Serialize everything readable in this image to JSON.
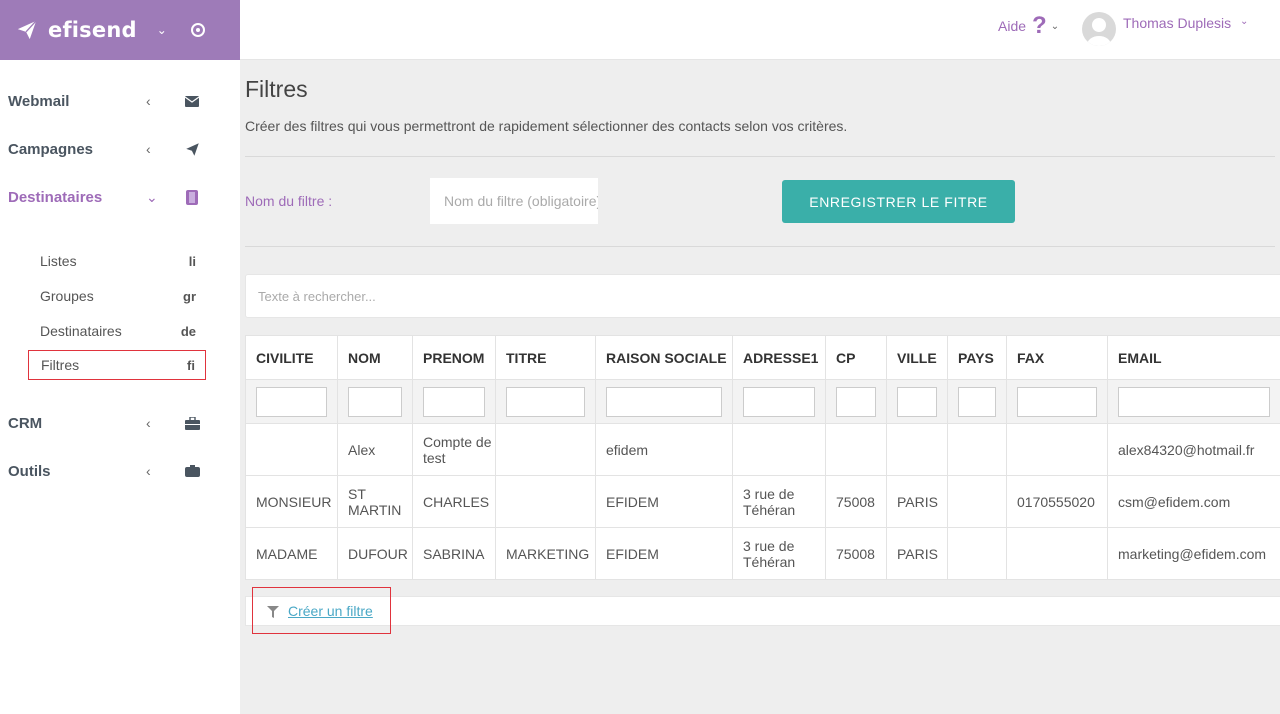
{
  "brand": {
    "name": "efisend"
  },
  "sidebar": {
    "items": [
      {
        "label": "Webmail",
        "icon": "envelope-icon"
      },
      {
        "label": "Campagnes",
        "icon": "paper-plane-icon"
      },
      {
        "label": "Destinataires",
        "icon": "address-book-icon"
      },
      {
        "label": "CRM",
        "icon": "briefcase-icon"
      },
      {
        "label": "Outils",
        "icon": "toolbox-icon"
      }
    ],
    "subitems": [
      {
        "label": "Listes",
        "abbr": "li"
      },
      {
        "label": "Groupes",
        "abbr": "gr"
      },
      {
        "label": "Destinataires",
        "abbr": "de"
      },
      {
        "label": "Filtres",
        "abbr": "fi"
      }
    ]
  },
  "header": {
    "help_label": "Aide",
    "help_symbol": "?",
    "user_name": "Thomas Duplesis"
  },
  "main": {
    "title": "Filtres",
    "description": "Créer des filtres qui vous permettront de rapidement sélectionner des contacts selon vos critères.",
    "filter_name_label": "Nom du filtre :",
    "filter_name_placeholder": "Nom du filtre (obligatoire)",
    "save_button": "ENREGISTRER LE FITRE",
    "search_placeholder": "Texte à rechercher...",
    "create_filter_link": "Créer un filtre"
  },
  "table": {
    "columns": [
      "CIVILITE",
      "NOM",
      "PRENOM",
      "TITRE",
      "RAISON SOCIALE",
      "ADRESSE1",
      "CP",
      "VILLE",
      "PAYS",
      "FAX",
      "EMAIL"
    ],
    "rows": [
      [
        "",
        "Alex",
        "Compte de test",
        "",
        "efidem",
        "",
        "",
        "",
        "",
        "",
        "alex84320@hotmail.fr"
      ],
      [
        "MONSIEUR",
        "ST MARTIN",
        "CHARLES",
        "",
        "EFIDEM",
        "3 rue de Téhéran",
        "75008",
        "PARIS",
        "",
        "0170555020",
        "csm@efidem.com"
      ],
      [
        "MADAME",
        "DUFOUR",
        "SABRINA",
        "MARKETING",
        "EFIDEM",
        "3 rue de Téhéran",
        "75008",
        "PARIS",
        "",
        "",
        "marketing@efidem.com"
      ]
    ]
  },
  "colors": {
    "brand_purple": "#9e7bb8",
    "accent_purple": "#9e6bb8",
    "teal_button": "#3aafa9",
    "link_blue": "#4aa8c6",
    "highlight_red": "#e0333d"
  }
}
